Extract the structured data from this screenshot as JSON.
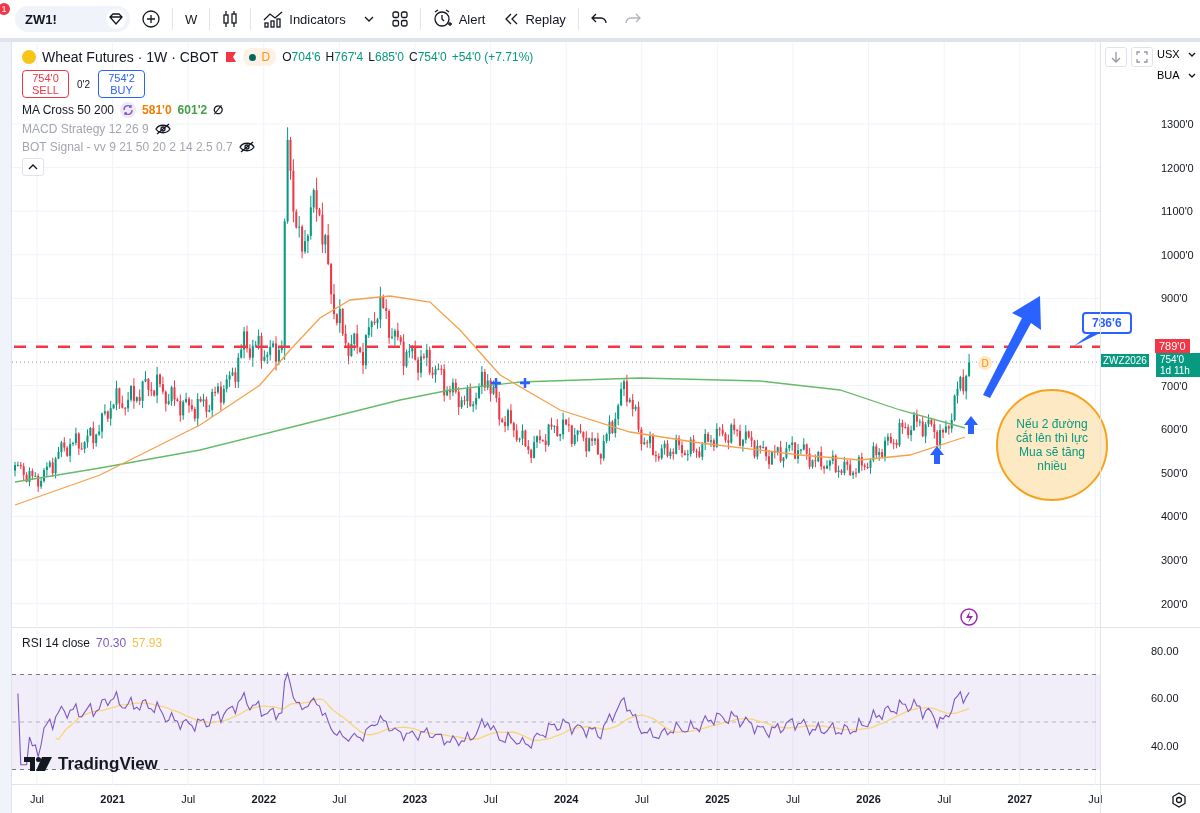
{
  "toolbar": {
    "symbol": "ZW1!",
    "notification_count": "1",
    "interval": "W",
    "indicators": "Indicators",
    "alert": "Alert",
    "replay": "Replay"
  },
  "legend": {
    "title": "Wheat Futures · 1W · CBOT",
    "session": "D",
    "ohlc": [
      {
        "label": "O",
        "value": "704'6"
      },
      {
        "label": "H",
        "value": "767'4"
      },
      {
        "label": "L",
        "value": "685'0"
      },
      {
        "label": "C",
        "value": "754'0"
      }
    ],
    "change": "+54'0 (+7.71%)"
  },
  "order": {
    "sell_price": "754'0",
    "sell_label": "SELL",
    "spread": "0'2",
    "buy_price": "754'2",
    "buy_label": "BUY"
  },
  "indicators": [
    {
      "name": "MA Cross 50 200",
      "hidden": false,
      "values": [
        {
          "text": "581'0",
          "color": "#f57c00"
        },
        {
          "text": "601'2",
          "color": "#43a047"
        },
        {
          "text": "∅",
          "color": "#131722"
        }
      ]
    },
    {
      "name": "MACD Strategy 12 26 9",
      "hidden": true
    },
    {
      "name": "BOT Signal - vv 9 21 50 20 2 14 2.5 0.7",
      "hidden": true
    }
  ],
  "price_axis": {
    "currency": "USX",
    "unit": "BUA",
    "ticks_upper": [
      "1300'0",
      "1200'0",
      "1100'0",
      "1000'0",
      "900'0"
    ],
    "ticks_lower": [
      "700'0",
      "600'0",
      "500'0",
      "400'0",
      "300'0",
      "200'0"
    ]
  },
  "price_tags": {
    "alert_level": "789'0",
    "symbol": "ZWZ2026",
    "last_price": "754'0",
    "countdown": "1d 11h"
  },
  "annotations": {
    "callout": "786'6",
    "marker": "D",
    "note": "Nếu 2 đường cắt lên thì lực Mua sẽ tăng nhiều"
  },
  "rsi": {
    "title": "RSI 14 close",
    "value": "70.30",
    "ma_value": "57.93",
    "ticks": [
      "80.00",
      "60.00",
      "40.00"
    ]
  },
  "logo": "TradingView",
  "time_axis": {
    "labels": [
      "Jul",
      "2021",
      "Jul",
      "2022",
      "Jul",
      "2023",
      "Jul",
      "2024",
      "Jul",
      "2025",
      "Jul",
      "2026",
      "Jul",
      "2027",
      "Jul"
    ]
  }
}
